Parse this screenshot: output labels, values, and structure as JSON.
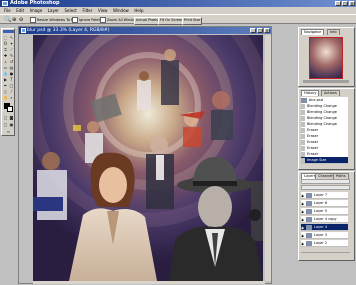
{
  "window": {
    "title": "Adobe Photoshop"
  },
  "menu": [
    "File",
    "Edit",
    "Image",
    "Layer",
    "Select",
    "Filter",
    "View",
    "Window",
    "Help"
  ],
  "options": {
    "resize_window_label": "Resize Windows To Fit",
    "ignore_palettes_label": "Ignore Palettes",
    "zoom_all_label": "Zoom All Windows",
    "actual_pixels_label": "Actual Pixels",
    "fit_on_screen_label": "Fit On Screen",
    "print_size_label": "Print Size"
  },
  "document": {
    "title": "blur psd @ 33.3% (Layer 4, RGB/8#)"
  },
  "navigator": {
    "tabs": [
      "Navigator",
      "Info"
    ]
  },
  "history": {
    "tabs": [
      "History",
      "Actions"
    ],
    "items": [
      "blur.psd",
      "Blending Change",
      "Blending Change",
      "Blending Change",
      "Blending Change",
      "Eraser",
      "Eraser",
      "Eraser",
      "Eraser",
      "Eraser",
      "Image Size"
    ]
  },
  "layers": {
    "tabs": [
      "Layers",
      "Channels",
      "Paths"
    ],
    "items": [
      "Layer 7",
      "Layer 6",
      "Layer 5",
      "Layer 4 copy",
      "Layer 4",
      "Layer 3",
      "Layer 2"
    ]
  }
}
